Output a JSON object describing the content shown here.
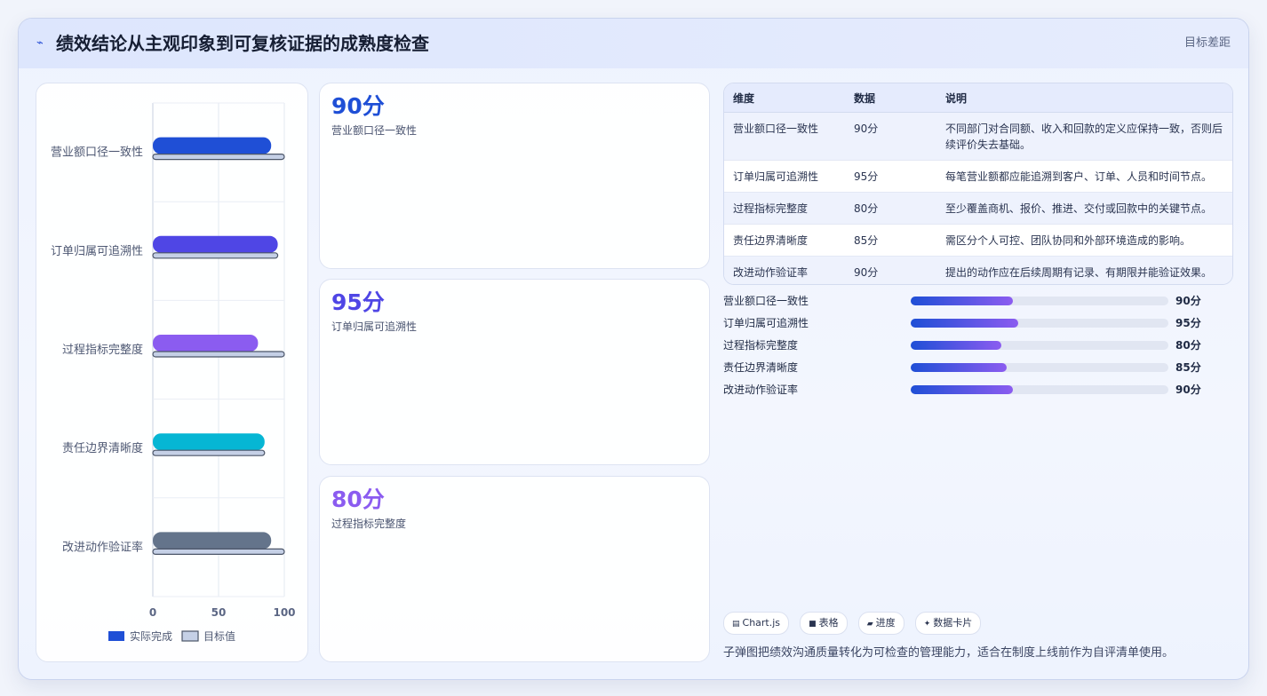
{
  "header": {
    "icon": "trend-line-icon",
    "title": "绩效结论从主观印象到可复核证据的成熟度检查",
    "right_label": "目标差距"
  },
  "stats": [
    {
      "value": "90分",
      "label": "营业额口径一致性",
      "color": "#1f4fd6"
    },
    {
      "value": "95分",
      "label": "订单归属可追溯性",
      "color": "#4f46e5"
    },
    {
      "value": "80分",
      "label": "过程指标完整度",
      "color": "#8b5cf0"
    }
  ],
  "table": {
    "headers": [
      "维度",
      "数据",
      "说明"
    ],
    "rows": [
      {
        "dim": "营业额口径一致性",
        "value": "90分",
        "desc": "不同部门对合同额、收入和回款的定义应保持一致，否则后续评价失去基础。"
      },
      {
        "dim": "订单归属可追溯性",
        "value": "95分",
        "desc": "每笔营业额都应能追溯到客户、订单、人员和时间节点。"
      },
      {
        "dim": "过程指标完整度",
        "value": "80分",
        "desc": "至少覆盖商机、报价、推进、交付或回款中的关键节点。"
      },
      {
        "dim": "责任边界清晰度",
        "value": "85分",
        "desc": "需区分个人可控、团队协同和外部环境造成的影响。"
      },
      {
        "dim": "改进动作验证率",
        "value": "90分",
        "desc": "提出的动作应在后续周期有记录、有期限并能验证效果。"
      }
    ]
  },
  "progress": [
    {
      "label": "营业额口径一致性",
      "value": 90,
      "value_label": "90分"
    },
    {
      "label": "订单归属可追溯性",
      "value": 95,
      "value_label": "95分"
    },
    {
      "label": "过程指标完整度",
      "value": 80,
      "value_label": "80分"
    },
    {
      "label": "责任边界清晰度",
      "value": 85,
      "value_label": "85分"
    },
    {
      "label": "改进动作验证率",
      "value": 90,
      "value_label": "90分"
    }
  ],
  "chips": [
    {
      "icon": "chart-icon",
      "glyph": "▤",
      "label": "Chart.js"
    },
    {
      "icon": "table-icon",
      "glyph": "■",
      "label": "表格"
    },
    {
      "icon": "progress-icon",
      "glyph": "▰",
      "label": "进度"
    },
    {
      "icon": "sparkle-icon",
      "glyph": "✦",
      "label": "数据卡片"
    }
  ],
  "footer_note": "子弹图把绩效沟通质量转化为可检查的管理能力，适合在制度上线前作为自评清单使用。",
  "chart_data": {
    "type": "bar",
    "orientation": "horizontal",
    "categories": [
      "营业额口径一致性",
      "订单归属可追溯性",
      "过程指标完整度",
      "责任边界清晰度",
      "改进动作验证率"
    ],
    "series": [
      {
        "name": "实际完成",
        "values": [
          90,
          95,
          80,
          85,
          90
        ],
        "colors": [
          "#1f4fd6",
          "#4f46e5",
          "#8b5cf0",
          "#06b6d4",
          "#64748b"
        ]
      },
      {
        "name": "目标值",
        "values": [
          100,
          95,
          100,
          85,
          100
        ],
        "color": "#c5d0e6",
        "border": "#4b5568"
      }
    ],
    "xlim": [
      0,
      100
    ],
    "xticks": [
      "0",
      "50",
      "100"
    ],
    "grid": true,
    "legend_position": "bottom"
  }
}
